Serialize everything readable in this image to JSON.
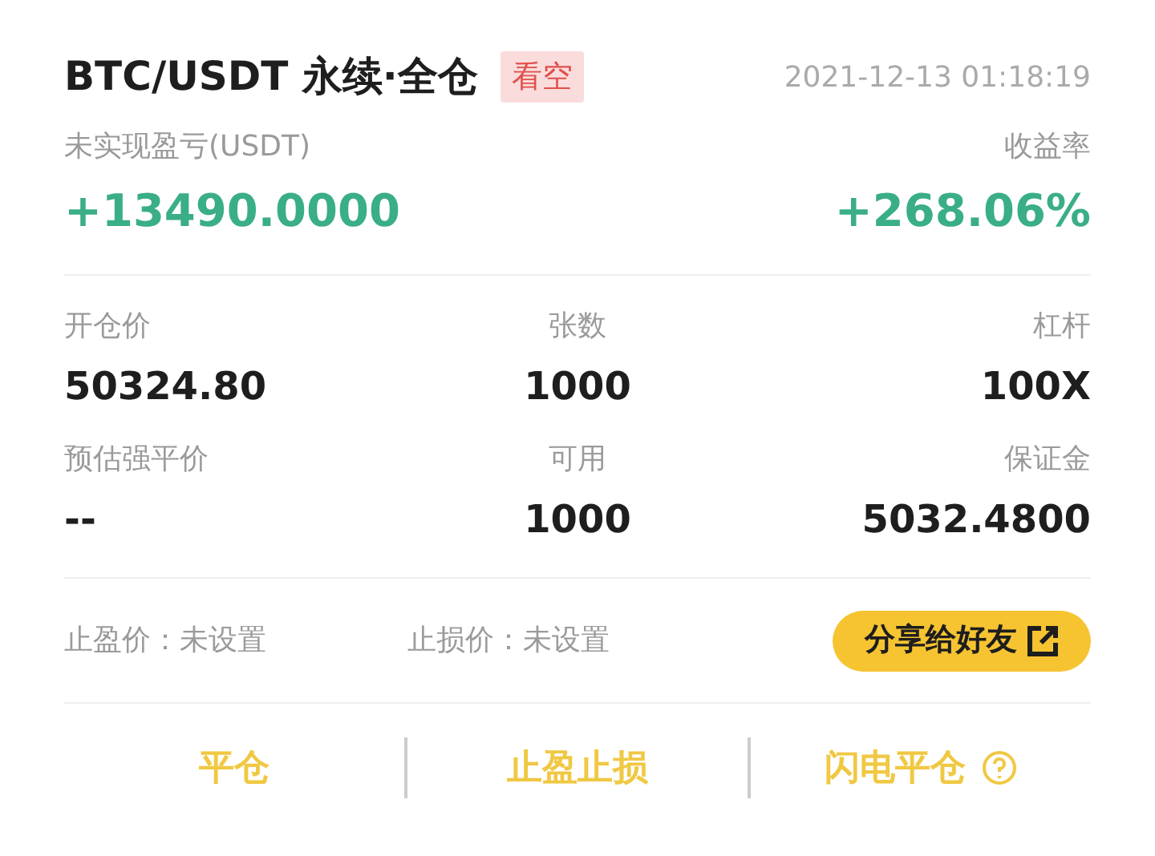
{
  "header": {
    "title": "BTC/USDT 永续·全仓",
    "side_badge": "看空",
    "time": "2021-12-13 01:18:19"
  },
  "pnl": {
    "label": "未实现盈亏(USDT)",
    "value": "+13490.0000",
    "rate_label": "收益率",
    "rate": "+268.06%"
  },
  "stats": [
    {
      "label": "开仓价",
      "value": "50324.80"
    },
    {
      "label": "张数",
      "value": "1000"
    },
    {
      "label": "杠杆",
      "value": "100X"
    },
    {
      "label": "预估强平价",
      "value": "--"
    },
    {
      "label": "可用",
      "value": "1000"
    },
    {
      "label": "保证金",
      "value": "5032.4800"
    }
  ],
  "orders": [
    {
      "label": "止盈价：",
      "value": "未设置"
    },
    {
      "label": "止损价：",
      "value": "未设置"
    }
  ],
  "share_button": "分享给好友",
  "actions": [
    {
      "label": "平仓"
    },
    {
      "label": "止盈止损"
    },
    {
      "label": "闪电平仓",
      "help": true
    }
  ]
}
